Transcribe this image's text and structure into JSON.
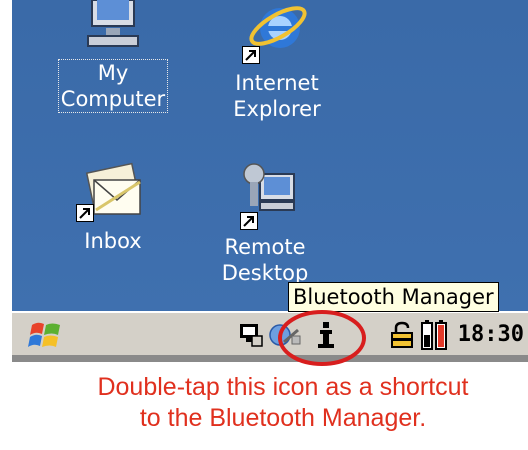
{
  "desktop_icons": {
    "my_computer": "My\nComputer",
    "internet_explorer": "Internet\nExplorer",
    "inbox": "Inbox",
    "remote_desktop": "Remote\nDesktop"
  },
  "tooltip": "Bluetooth Manager",
  "taskbar": {
    "clock": "18:30",
    "tray_icons": [
      "network-icon",
      "connection-icon",
      "bluetooth-manager-icon",
      "lock-icon",
      "battery-icon"
    ]
  },
  "callout": {
    "line1": "Double-tap this icon as a shortcut",
    "line2": "to the Bluetooth Manager."
  },
  "colors": {
    "desktop": "#3f6fae",
    "taskbar": "#d4d0c8",
    "tooltip_bg": "#ffffe1",
    "highlight_circle": "#d81e1e",
    "callout_text": "#e0301e"
  }
}
